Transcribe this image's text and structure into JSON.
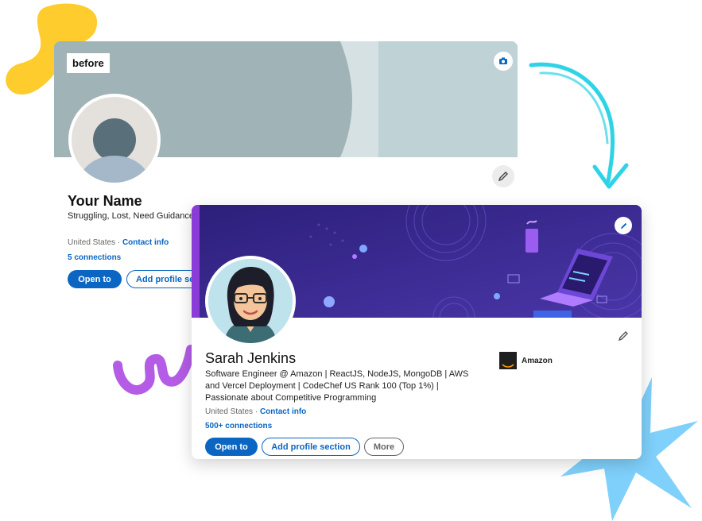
{
  "before": {
    "tag": "before",
    "name": "Your Name",
    "headline": "Struggling, Lost, Need Guidance",
    "location": "United States",
    "separator": "·",
    "contact_info": "Contact info",
    "connections": "5 connections",
    "open_to": "Open to",
    "add_section": "Add profile section"
  },
  "after": {
    "name": "Sarah Jenkins",
    "headline": "Software Engineer @ Amazon | ReactJS, NodeJS, MongoDB | AWS and Vercel Deployment | CodeChef US Rank 100 (Top 1%) | Passionate about Competitive Programming",
    "company": "Amazon",
    "location": "United States",
    "separator": "·",
    "contact_info": "Contact info",
    "connections": "500+ connections",
    "open_to": "Open to",
    "add_section": "Add profile section",
    "more": "More"
  },
  "icons": {
    "camera": "camera-icon",
    "pencil": "pencil-icon",
    "arrow": "curved-arrow-icon"
  },
  "colors": {
    "accent": "#0a66c2",
    "before_banner": "#a9b9bc",
    "after_banner": "#3b2a8f"
  }
}
